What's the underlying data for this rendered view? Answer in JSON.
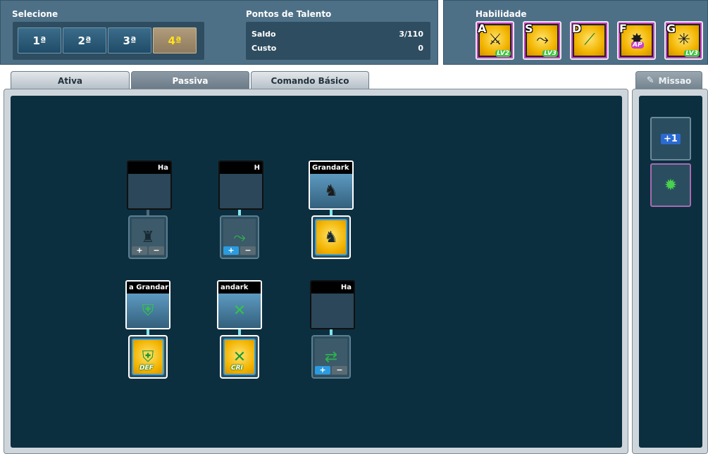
{
  "selecione": {
    "title": "Selecione",
    "options": [
      "1ª",
      "2ª",
      "3ª",
      "4ª"
    ],
    "active_index": 3
  },
  "talent": {
    "title": "Pontos de Talento",
    "saldo_label": "Saldo",
    "saldo_value": "3/110",
    "custo_label": "Custo",
    "custo_value": "0"
  },
  "habilidade": {
    "title": "Habilidade",
    "skills": [
      {
        "key": "A",
        "level": "LV2",
        "icon": "dual-blade-icon"
      },
      {
        "key": "S",
        "level": "LV3",
        "icon": "slash-dash-icon"
      },
      {
        "key": "D",
        "level": "",
        "icon": "green-sword-icon"
      },
      {
        "key": "F",
        "level": "AP",
        "icon": "spike-burst-icon"
      },
      {
        "key": "G",
        "level": "LV3",
        "icon": "ground-spike-icon"
      }
    ]
  },
  "tabs": [
    "Ativa",
    "Passiva",
    "Comando Básico"
  ],
  "active_tab": 1,
  "side_tab": "Missao",
  "tree": {
    "row1": [
      {
        "name": "Ha",
        "state": "dim",
        "slot": "locked"
      },
      {
        "name": "H",
        "state": "dim",
        "slot": "available"
      },
      {
        "name": "Grandark",
        "state": "active",
        "slot": "filled"
      }
    ],
    "row2": [
      {
        "name": "a Grandar",
        "state": "active",
        "slot": "filled",
        "badge": "DEF"
      },
      {
        "name": "andark",
        "state": "active",
        "slot": "filled",
        "badge": "CRI"
      },
      {
        "name": "Ha",
        "state": "dim",
        "slot": "available"
      }
    ]
  },
  "side_items": [
    {
      "icon": "plus-one-icon",
      "label": "+1"
    },
    {
      "icon": "green-orb-icon",
      "label": ""
    }
  ]
}
